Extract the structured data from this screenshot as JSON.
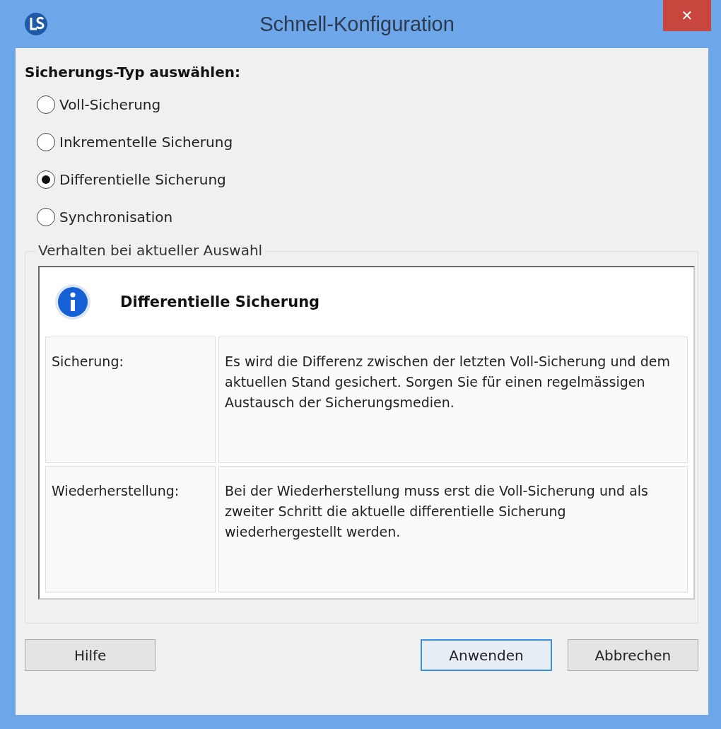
{
  "window": {
    "title": "Schnell-Konfiguration",
    "close_glyph": "✕"
  },
  "heading": "Sicherungs-Typ auswählen:",
  "options": [
    {
      "label": "Voll-Sicherung",
      "selected": false
    },
    {
      "label": "Inkrementelle Sicherung",
      "selected": false
    },
    {
      "label": "Differentielle Sicherung",
      "selected": true
    },
    {
      "label": "Synchronisation",
      "selected": false
    }
  ],
  "group": {
    "title": "Verhalten bei aktueller Auswahl",
    "info_title": "Differentielle Sicherung",
    "rows": [
      {
        "label": "Sicherung:",
        "text": "Es wird die Differenz zwischen der letzten Voll-Sicherung und dem aktuellen Stand gesichert. Sorgen Sie für einen regelmässigen Austausch der Sicherungsmedien."
      },
      {
        "label": "Wiederherstellung:",
        "text": "Bei der Wiederherstellung muss erst die Voll-Sicherung und als zweiter Schritt die aktuelle differentielle Sicherung wiederhergestellt werden."
      }
    ]
  },
  "buttons": [
    {
      "label": "Hilfe",
      "focused": false
    },
    {
      "label": "Anwenden",
      "focused": true
    },
    {
      "label": "Abbrechen",
      "focused": false
    }
  ]
}
